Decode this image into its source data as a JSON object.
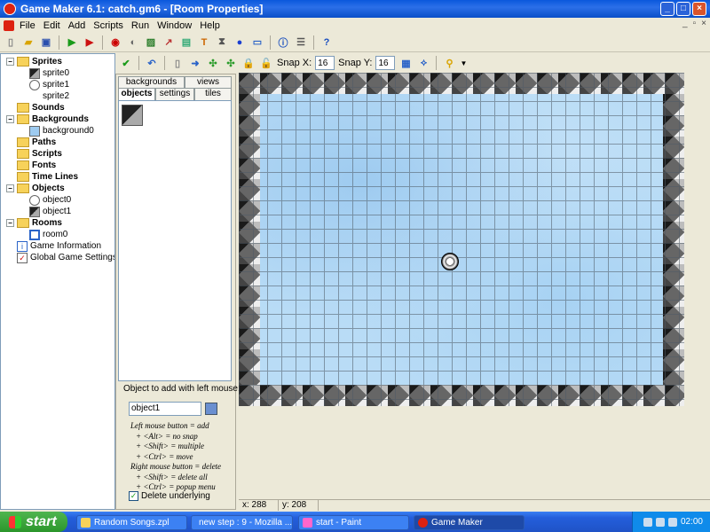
{
  "window": {
    "title": "Game Maker 6.1: catch.gm6 - [Room Properties]"
  },
  "menu": [
    "File",
    "Edit",
    "Add",
    "Scripts",
    "Run",
    "Window",
    "Help"
  ],
  "tree": {
    "sprites": "Sprites",
    "sprite0": "sprite0",
    "sprite1": "sprite1",
    "sprite2": "sprite2",
    "sounds": "Sounds",
    "backgrounds": "Backgrounds",
    "background0": "background0",
    "paths": "Paths",
    "scripts": "Scripts",
    "fonts": "Fonts",
    "timelines": "Time Lines",
    "objects": "Objects",
    "object0": "object0",
    "object1": "object1",
    "rooms": "Rooms",
    "room0": "room0",
    "game_info": "Game Information",
    "global_settings": "Global Game Settings"
  },
  "room_toolbar": {
    "snap_x_label": "Snap X:",
    "snap_x": "16",
    "snap_y_label": "Snap Y:",
    "snap_y": "16"
  },
  "tabs": {
    "backgrounds": "backgrounds",
    "views": "views",
    "objects": "objects",
    "settings": "settings",
    "tiles": "tiles"
  },
  "left_panel": {
    "add_label": "Object to add with left mouse:",
    "object_value": "object1",
    "help_lines": [
      "Left mouse button = add",
      "+ <Alt> = no snap",
      "+ <Shift> = multiple",
      "+ <Ctrl> = move",
      "Right mouse button = delete",
      "+ <Shift> = delete all",
      "+ <Ctrl> = popup menu"
    ],
    "delete_underlying": "Delete underlying"
  },
  "status": {
    "x": "x: 288",
    "y": "y: 208"
  },
  "taskbar": {
    "start": "start",
    "tasks": [
      "Random Songs.zpl",
      "new step : 9 - Mozilla ...",
      "start - Paint",
      "Game Maker"
    ],
    "clock": "02:00"
  }
}
